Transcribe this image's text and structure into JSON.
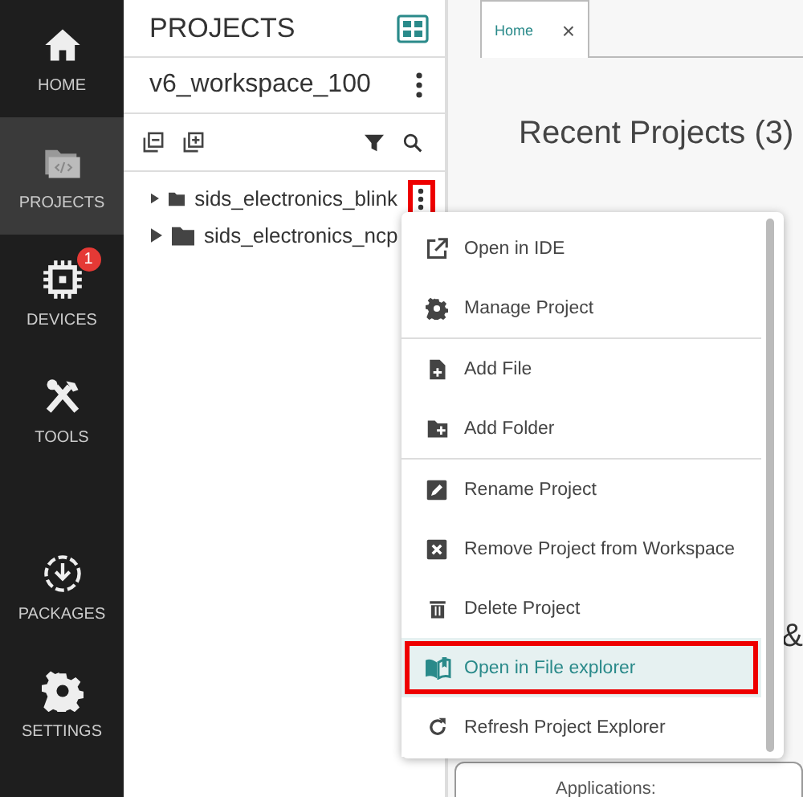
{
  "sidebar": {
    "items": [
      {
        "label": "HOME",
        "selected": false
      },
      {
        "label": "PROJECTS",
        "selected": true
      },
      {
        "label": "DEVICES",
        "selected": false,
        "badge": "1"
      },
      {
        "label": "TOOLS",
        "selected": false
      },
      {
        "label": "PACKAGES",
        "selected": false
      },
      {
        "label": "SETTINGS",
        "selected": false
      }
    ]
  },
  "panel": {
    "title": "PROJECTS",
    "workspace": "v6_workspace_100",
    "tree": [
      {
        "label": "sids_electronics_blink",
        "expanded": false,
        "outlined": true
      },
      {
        "label": "sids_electronics_ncp",
        "expanded": false,
        "outlined": false
      }
    ]
  },
  "tabs": [
    {
      "label": "Home",
      "selected": true,
      "close": "×"
    }
  ],
  "main": {
    "heading": "Recent Projects (3)",
    "partial_heading": "&",
    "card_label": "Applications:"
  },
  "context_menu": {
    "groups": [
      [
        {
          "label": "Open in IDE",
          "selected": false,
          "outlined": false
        },
        {
          "label": "Manage Project",
          "selected": false,
          "outlined": false
        }
      ],
      [
        {
          "label": "Add File",
          "selected": false,
          "outlined": false
        },
        {
          "label": "Add Folder",
          "selected": false,
          "outlined": false
        }
      ],
      [
        {
          "label": "Rename Project",
          "selected": false,
          "outlined": false
        },
        {
          "label": "Remove Project from Workspace",
          "selected": false,
          "outlined": false
        },
        {
          "label": "Delete Project",
          "selected": false,
          "outlined": false
        },
        {
          "label": "Open in File explorer",
          "selected": true,
          "outlined": true
        },
        {
          "label": "Refresh Project Explorer",
          "selected": false,
          "outlined": false
        }
      ]
    ]
  }
}
